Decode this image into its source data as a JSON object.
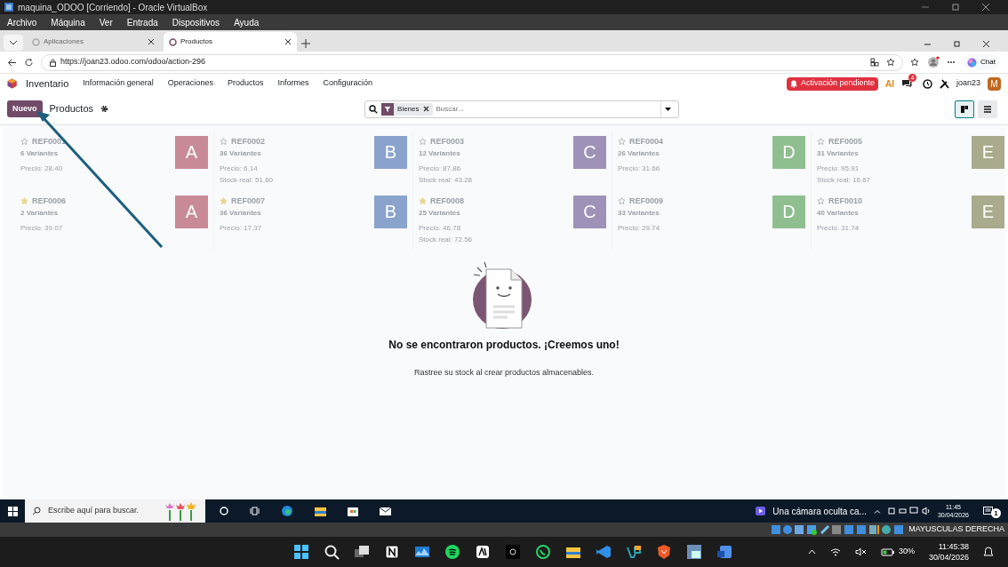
{
  "vm_window": {
    "title": "maquina_ODOO [Corriendo] - Oracle VirtualBox",
    "menu": [
      "Archivo",
      "Máquina",
      "Ver",
      "Entrada",
      "Dispositivos",
      "Ayuda"
    ]
  },
  "browser": {
    "tabs": [
      {
        "label": "Aplicaciones",
        "selected": false
      },
      {
        "label": "Productos",
        "selected": true
      }
    ],
    "url": "https://joan23.odoo.com/odoo/action-296",
    "chat_button": "Chat"
  },
  "app_bar": {
    "app_name": "Inventario",
    "menu": [
      "Información general",
      "Operaciones",
      "Productos",
      "Informes",
      "Configuración"
    ],
    "activation": "Activación pendiente",
    "ai_label": "AI",
    "message_count": "4",
    "user": "joan23",
    "avatar": "M"
  },
  "control_panel": {
    "new_button": "Nuevo",
    "breadcrumb": "Productos",
    "facets": [
      "Bienes"
    ],
    "search_placeholder": "Buscar...",
    "views": [
      {
        "kind": "kanban",
        "selected": true
      },
      {
        "kind": "list",
        "selected": false
      }
    ]
  },
  "sample_cards": [
    {
      "ref": "REF0001",
      "variants": "6 Variantes",
      "price": "Precio: 28.40",
      "favorite": false,
      "letter": "A",
      "color": "#c98a97"
    },
    {
      "ref": "REF0002",
      "variants": "36 Variantes",
      "price": "Precio: 6.14",
      "stock": "Stock real: 51.60",
      "favorite": false,
      "letter": "B",
      "color": "#8aa3cc"
    },
    {
      "ref": "REF0003",
      "variants": "12 Variantes",
      "price": "Precio: 87.86",
      "stock": "Stock real: 43.28",
      "favorite": false,
      "letter": "C",
      "color": "#9e92b8"
    },
    {
      "ref": "REF0004",
      "variants": "26 Variantes",
      "price": "Precio: 31.66",
      "favorite": false,
      "letter": "D",
      "color": "#8fbf8f"
    },
    {
      "ref": "REF0005",
      "variants": "31 Variantes",
      "price": "Precio: 95.91",
      "stock": "Stock real: 16.67",
      "favorite": false,
      "letter": "E",
      "color": "#a9ab8c"
    },
    {
      "ref": "REF0006",
      "variants": "2 Variantes",
      "price": "Precio: 39.07",
      "favorite": true,
      "letter": "A",
      "color": "#c98a97"
    },
    {
      "ref": "REF0007",
      "variants": "36 Variantes",
      "price": "Precio: 17.37",
      "favorite": true,
      "letter": "B",
      "color": "#8aa3cc"
    },
    {
      "ref": "REF0008",
      "variants": "25 Variantes",
      "price": "Precio: 46.78",
      "stock": "Stock real: 72.56",
      "favorite": true,
      "letter": "C",
      "color": "#9e92b8"
    },
    {
      "ref": "REF0009",
      "variants": "33 Variantes",
      "price": "Precio: 29.74",
      "favorite": false,
      "letter": "D",
      "color": "#8fbf8f"
    },
    {
      "ref": "REF0010",
      "variants": "40 Variantes",
      "price": "Precio: 31.74",
      "favorite": false,
      "letter": "E",
      "color": "#a9ab8c"
    }
  ],
  "empty_state": {
    "title": "No se encontraron productos. ¡Creemos uno!",
    "text": "Rastree su stock al crear productos almacenables."
  },
  "guest_taskbar": {
    "search_placeholder": "Escribe aquí para buscar.",
    "notification": "Una cámara oculta ca...",
    "time": "11:45",
    "date": "30/04/2026",
    "notification_count": "1"
  },
  "vm_status": {
    "keyboard": "MAYUSCULAS DERECHA"
  },
  "host_taskbar": {
    "battery": "30%",
    "time": "11:45:38",
    "date": "30/04/2026"
  }
}
